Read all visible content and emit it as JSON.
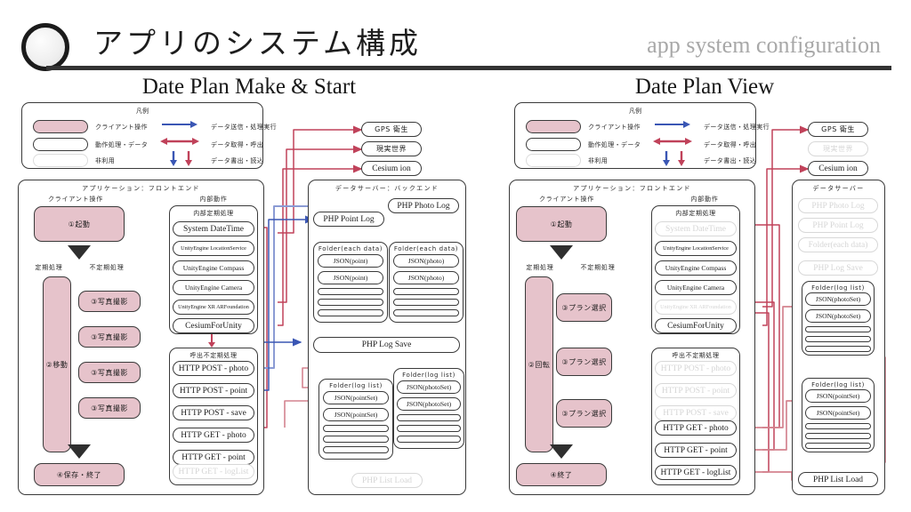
{
  "header": {
    "title_jp": "アプリのシステム構成",
    "title_en": "app system configuration",
    "logo_icon": "circle-logo-icon"
  },
  "sections": [
    {
      "id": "left",
      "title": "Date Plan Make & Start"
    },
    {
      "id": "right",
      "title": "Date Plan View"
    }
  ],
  "legend": {
    "title": "凡例",
    "rows": [
      {
        "swatch": "pink",
        "label": "クライアント操作",
        "arrow": "データ送信・処理実行"
      },
      {
        "swatch": "white",
        "label": "動作処理・データ",
        "arrow": "データ取得・呼出"
      },
      {
        "swatch": "disabled",
        "label": "非利用",
        "arrow": "データ書出・読込"
      }
    ]
  },
  "colors": {
    "pink_fill": "#e6c3cb",
    "border": "#3a3a3a",
    "disabled": "#d5d5d5",
    "arrow_blue": "#3a56b4",
    "arrow_red": "#c0425a",
    "arrow_red_light": "#d4838f",
    "arrow_blue_light": "#8b9bd4",
    "rule": "#333333",
    "subtitle_gray": "#a8a8a8"
  },
  "external": {
    "left": [
      {
        "label": "GPS 衛生",
        "state": "on"
      },
      {
        "label": "現実世界",
        "state": "on"
      },
      {
        "label": "Cesium ion",
        "state": "on"
      }
    ],
    "right": [
      {
        "label": "GPS 衛生",
        "state": "on"
      },
      {
        "label": "現実世界",
        "state": "off"
      },
      {
        "label": "Cesium ion",
        "state": "on"
      }
    ]
  },
  "left": {
    "frontend": {
      "title": "アプリケーション：フロントエンド",
      "client_col_label": "クライアント操作",
      "internal_col_label": "内部動作",
      "periodic_label": "定期処理",
      "aperiodic_label": "不定期処理",
      "client_nodes": {
        "start": "①起動",
        "periodic": "②移動",
        "end": "④保存・終了",
        "aperiodic": [
          "③写真撮影",
          "③写真撮影",
          "③写真撮影",
          "③写真撮影"
        ]
      },
      "internal_periodic": {
        "title": "内部定期処理",
        "items": [
          {
            "label": "System DateTime",
            "state": "on"
          },
          {
            "label": "UnityEngine LocationService",
            "state": "on"
          },
          {
            "label": "UnityEngine Compass",
            "state": "on"
          },
          {
            "label": "UnityEngine Camera",
            "state": "on"
          },
          {
            "label": "UnityEngine XR ARFoundation",
            "state": "on"
          },
          {
            "label": "CesiumForUnity",
            "state": "on"
          }
        ]
      },
      "internal_aperiodic": {
        "title": "呼出不定期処理",
        "items": [
          {
            "label": "HTTP POST - photo",
            "state": "on"
          },
          {
            "label": "HTTP POST - point",
            "state": "on"
          },
          {
            "label": "HTTP POST - save",
            "state": "on"
          },
          {
            "label": "HTTP GET - photo",
            "state": "on"
          },
          {
            "label": "HTTP GET - point",
            "state": "on"
          },
          {
            "label": "HTTP GET - logList",
            "state": "off"
          }
        ]
      }
    },
    "backend": {
      "title": "データサーバー：バックエンド",
      "php_point_log": {
        "label": "PHP Point Log",
        "state": "on"
      },
      "php_photo_log": {
        "label": "PHP Photo Log",
        "state": "on"
      },
      "php_log_save": {
        "label": "PHP Log Save",
        "state": "on"
      },
      "php_list_load": {
        "label": "PHP List Load",
        "state": "off"
      },
      "folder_point": {
        "title": "Folder(each data)",
        "items": [
          {
            "label": "JSON(point)",
            "state": "on"
          },
          {
            "label": "JSON(point)",
            "state": "on"
          },
          {
            "label": "",
            "state": "bar"
          },
          {
            "label": "",
            "state": "bar"
          },
          {
            "label": "",
            "state": "bar"
          }
        ]
      },
      "folder_photo": {
        "title": "Folder(each data)",
        "items": [
          {
            "label": "JSON(photo)",
            "state": "on"
          },
          {
            "label": "JSON(photo)",
            "state": "on"
          },
          {
            "label": "",
            "state": "bar"
          },
          {
            "label": "",
            "state": "bar"
          },
          {
            "label": "",
            "state": "bar"
          }
        ]
      },
      "folder_pointset": {
        "title": "Folder(log list)",
        "items": [
          {
            "label": "JSON(pointSet)",
            "state": "on"
          },
          {
            "label": "JSON(pointSet)",
            "state": "on"
          },
          {
            "label": "",
            "state": "bar"
          },
          {
            "label": "",
            "state": "bar"
          },
          {
            "label": "",
            "state": "bar"
          }
        ]
      },
      "folder_photoset": {
        "title": "Folder(log list)",
        "items": [
          {
            "label": "JSON(photoSet)",
            "state": "on"
          },
          {
            "label": "JSON(photoSet)",
            "state": "on"
          },
          {
            "label": "",
            "state": "bar"
          },
          {
            "label": "",
            "state": "bar"
          },
          {
            "label": "",
            "state": "bar"
          }
        ]
      }
    }
  },
  "right": {
    "frontend": {
      "title": "アプリケーション：フロントエンド",
      "client_col_label": "クライアント操作",
      "internal_col_label": "内部動作",
      "periodic_label": "定期処理",
      "aperiodic_label": "不定期処理",
      "client_nodes": {
        "start": "①起動",
        "periodic": "②回転",
        "end": "④終了",
        "aperiodic": [
          "③プラン選択",
          "③プラン選択",
          "③プラン選択"
        ]
      },
      "internal_periodic": {
        "title": "内部定期処理",
        "items": [
          {
            "label": "System DateTime",
            "state": "off"
          },
          {
            "label": "UnityEngine LocationService",
            "state": "on"
          },
          {
            "label": "UnityEngine Compass",
            "state": "on"
          },
          {
            "label": "UnityEngine Camera",
            "state": "on"
          },
          {
            "label": "UnityEngine XR ARFoundation",
            "state": "off"
          },
          {
            "label": "CesiumForUnity",
            "state": "on"
          }
        ]
      },
      "internal_aperiodic": {
        "title": "呼出不定期処理",
        "items": [
          {
            "label": "HTTP POST - photo",
            "state": "off"
          },
          {
            "label": "HTTP POST - point",
            "state": "off"
          },
          {
            "label": "HTTP POST - save",
            "state": "off"
          },
          {
            "label": "HTTP GET - photo",
            "state": "on"
          },
          {
            "label": "HTTP GET - point",
            "state": "on"
          },
          {
            "label": "HTTP GET - logList",
            "state": "on"
          }
        ]
      }
    },
    "backend": {
      "title": "データサーバー",
      "dimmed": [
        {
          "label": "PHP Photo Log",
          "state": "off"
        },
        {
          "label": "PHP Point Log",
          "state": "off"
        },
        {
          "label": "Folder(each data)",
          "state": "off"
        },
        {
          "label": "PHP Log Save",
          "state": "off"
        }
      ],
      "php_list_load": {
        "label": "PHP List Load",
        "state": "on"
      },
      "folder_photoset": {
        "title": "Folder(log list)",
        "items": [
          {
            "label": "JSON(photoSet)",
            "state": "on"
          },
          {
            "label": "JSON(photoSet)",
            "state": "on"
          },
          {
            "label": "",
            "state": "bar"
          },
          {
            "label": "",
            "state": "bar"
          },
          {
            "label": "",
            "state": "bar"
          }
        ]
      },
      "folder_pointset": {
        "title": "Folder(log list)",
        "items": [
          {
            "label": "JSON(pointSet)",
            "state": "on"
          },
          {
            "label": "JSON(pointSet)",
            "state": "on"
          },
          {
            "label": "",
            "state": "bar"
          },
          {
            "label": "",
            "state": "bar"
          },
          {
            "label": "",
            "state": "bar"
          }
        ]
      }
    }
  }
}
